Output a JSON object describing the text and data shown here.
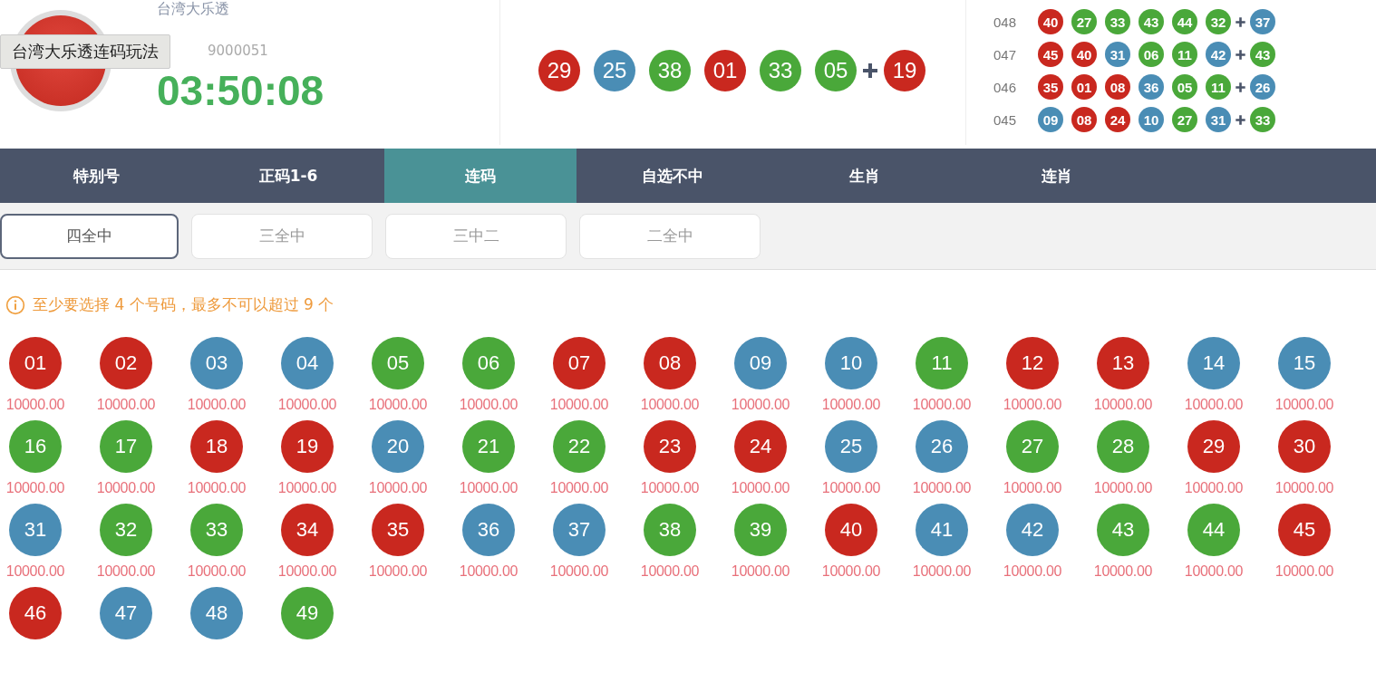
{
  "game": {
    "title": "台湾大乐透",
    "draw_no": "9000051",
    "countdown": "03:50:08",
    "tooltip": "台湾大乐透连码玩法"
  },
  "latest": {
    "balls": [
      {
        "number": "29",
        "color": "#c9281f"
      },
      {
        "number": "25",
        "color": "#4a8db5"
      },
      {
        "number": "38",
        "color": "#4aa83a"
      },
      {
        "number": "01",
        "color": "#c9281f"
      },
      {
        "number": "33",
        "color": "#4aa83a"
      },
      {
        "number": "05",
        "color": "#4aa83a"
      }
    ],
    "special": {
      "number": "19",
      "color": "#c9281f"
    }
  },
  "history": [
    {
      "issue": "048",
      "balls": [
        {
          "number": "40",
          "color": "#c9281f"
        },
        {
          "number": "27",
          "color": "#4aa83a"
        },
        {
          "number": "33",
          "color": "#4aa83a"
        },
        {
          "number": "43",
          "color": "#4aa83a"
        },
        {
          "number": "44",
          "color": "#4aa83a"
        },
        {
          "number": "32",
          "color": "#4aa83a"
        }
      ],
      "special": {
        "number": "37",
        "color": "#4a8db5"
      }
    },
    {
      "issue": "047",
      "balls": [
        {
          "number": "45",
          "color": "#c9281f"
        },
        {
          "number": "40",
          "color": "#c9281f"
        },
        {
          "number": "31",
          "color": "#4a8db5"
        },
        {
          "number": "06",
          "color": "#4aa83a"
        },
        {
          "number": "11",
          "color": "#4aa83a"
        },
        {
          "number": "42",
          "color": "#4a8db5"
        }
      ],
      "special": {
        "number": "43",
        "color": "#4aa83a"
      }
    },
    {
      "issue": "046",
      "balls": [
        {
          "number": "35",
          "color": "#c9281f"
        },
        {
          "number": "01",
          "color": "#c9281f"
        },
        {
          "number": "08",
          "color": "#c9281f"
        },
        {
          "number": "36",
          "color": "#4a8db5"
        },
        {
          "number": "05",
          "color": "#4aa83a"
        },
        {
          "number": "11",
          "color": "#4aa83a"
        }
      ],
      "special": {
        "number": "26",
        "color": "#4a8db5"
      }
    },
    {
      "issue": "045",
      "balls": [
        {
          "number": "09",
          "color": "#4a8db5"
        },
        {
          "number": "08",
          "color": "#c9281f"
        },
        {
          "number": "24",
          "color": "#c9281f"
        },
        {
          "number": "10",
          "color": "#4a8db5"
        },
        {
          "number": "27",
          "color": "#4aa83a"
        },
        {
          "number": "31",
          "color": "#4a8db5"
        }
      ],
      "special": {
        "number": "33",
        "color": "#4aa83a"
      }
    }
  ],
  "tabs": [
    {
      "label": "特别号",
      "selected": false
    },
    {
      "label": "正码1-6",
      "selected": false
    },
    {
      "label": "连码",
      "selected": true
    },
    {
      "label": "自选不中",
      "selected": false
    },
    {
      "label": "生肖",
      "selected": false
    },
    {
      "label": "连肖",
      "selected": false
    }
  ],
  "subtabs": [
    {
      "label": "四全中",
      "selected": true
    },
    {
      "label": "三全中",
      "selected": false
    },
    {
      "label": "三中二",
      "selected": false
    },
    {
      "label": "二全中",
      "selected": false
    }
  ],
  "notice": "至少要选择 4 个号码，最多不可以超过 9 个",
  "numbers": [
    {
      "number": "01",
      "color": "#c9281f",
      "odds": "10000.00"
    },
    {
      "number": "02",
      "color": "#c9281f",
      "odds": "10000.00"
    },
    {
      "number": "03",
      "color": "#4a8db5",
      "odds": "10000.00"
    },
    {
      "number": "04",
      "color": "#4a8db5",
      "odds": "10000.00"
    },
    {
      "number": "05",
      "color": "#4aa83a",
      "odds": "10000.00"
    },
    {
      "number": "06",
      "color": "#4aa83a",
      "odds": "10000.00"
    },
    {
      "number": "07",
      "color": "#c9281f",
      "odds": "10000.00"
    },
    {
      "number": "08",
      "color": "#c9281f",
      "odds": "10000.00"
    },
    {
      "number": "09",
      "color": "#4a8db5",
      "odds": "10000.00"
    },
    {
      "number": "10",
      "color": "#4a8db5",
      "odds": "10000.00"
    },
    {
      "number": "11",
      "color": "#4aa83a",
      "odds": "10000.00"
    },
    {
      "number": "12",
      "color": "#c9281f",
      "odds": "10000.00"
    },
    {
      "number": "13",
      "color": "#c9281f",
      "odds": "10000.00"
    },
    {
      "number": "14",
      "color": "#4a8db5",
      "odds": "10000.00"
    },
    {
      "number": "15",
      "color": "#4a8db5",
      "odds": "10000.00"
    },
    {
      "number": "16",
      "color": "#4aa83a",
      "odds": "10000.00"
    },
    {
      "number": "17",
      "color": "#4aa83a",
      "odds": "10000.00"
    },
    {
      "number": "18",
      "color": "#c9281f",
      "odds": "10000.00"
    },
    {
      "number": "19",
      "color": "#c9281f",
      "odds": "10000.00"
    },
    {
      "number": "20",
      "color": "#4a8db5",
      "odds": "10000.00"
    },
    {
      "number": "21",
      "color": "#4aa83a",
      "odds": "10000.00"
    },
    {
      "number": "22",
      "color": "#4aa83a",
      "odds": "10000.00"
    },
    {
      "number": "23",
      "color": "#c9281f",
      "odds": "10000.00"
    },
    {
      "number": "24",
      "color": "#c9281f",
      "odds": "10000.00"
    },
    {
      "number": "25",
      "color": "#4a8db5",
      "odds": "10000.00"
    },
    {
      "number": "26",
      "color": "#4a8db5",
      "odds": "10000.00"
    },
    {
      "number": "27",
      "color": "#4aa83a",
      "odds": "10000.00"
    },
    {
      "number": "28",
      "color": "#4aa83a",
      "odds": "10000.00"
    },
    {
      "number": "29",
      "color": "#c9281f",
      "odds": "10000.00"
    },
    {
      "number": "30",
      "color": "#c9281f",
      "odds": "10000.00"
    },
    {
      "number": "31",
      "color": "#4a8db5",
      "odds": "10000.00"
    },
    {
      "number": "32",
      "color": "#4aa83a",
      "odds": "10000.00"
    },
    {
      "number": "33",
      "color": "#4aa83a",
      "odds": "10000.00"
    },
    {
      "number": "34",
      "color": "#c9281f",
      "odds": "10000.00"
    },
    {
      "number": "35",
      "color": "#c9281f",
      "odds": "10000.00"
    },
    {
      "number": "36",
      "color": "#4a8db5",
      "odds": "10000.00"
    },
    {
      "number": "37",
      "color": "#4a8db5",
      "odds": "10000.00"
    },
    {
      "number": "38",
      "color": "#4aa83a",
      "odds": "10000.00"
    },
    {
      "number": "39",
      "color": "#4aa83a",
      "odds": "10000.00"
    },
    {
      "number": "40",
      "color": "#c9281f",
      "odds": "10000.00"
    },
    {
      "number": "41",
      "color": "#4a8db5",
      "odds": "10000.00"
    },
    {
      "number": "42",
      "color": "#4a8db5",
      "odds": "10000.00"
    },
    {
      "number": "43",
      "color": "#4aa83a",
      "odds": "10000.00"
    },
    {
      "number": "44",
      "color": "#4aa83a",
      "odds": "10000.00"
    },
    {
      "number": "45",
      "color": "#c9281f",
      "odds": "10000.00"
    },
    {
      "number": "46",
      "color": "#c9281f"
    },
    {
      "number": "47",
      "color": "#4a8db5"
    },
    {
      "number": "48",
      "color": "#4a8db5"
    },
    {
      "number": "49",
      "color": "#4aa83a"
    }
  ]
}
